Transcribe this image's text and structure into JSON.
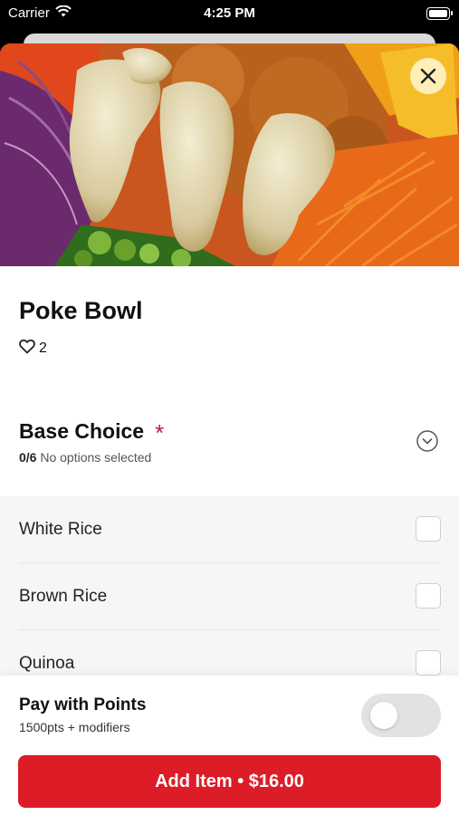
{
  "status_bar": {
    "carrier": "Carrier",
    "time": "4:25 PM"
  },
  "item": {
    "title": "Poke Bowl",
    "likes": "2"
  },
  "section": {
    "title": "Base Choice",
    "required_marker": "*",
    "count": "0/6",
    "status": "No options selected"
  },
  "options": [
    {
      "label": "White Rice"
    },
    {
      "label": "Brown Rice"
    },
    {
      "label": "Quinoa"
    }
  ],
  "footer": {
    "pay_title": "Pay with Points",
    "pay_sub": "1500pts + modifiers",
    "add_button": "Add Item • $16.00"
  },
  "colors": {
    "accent": "#dc1c26",
    "required": "#c2185b"
  },
  "icons": [
    "wifi-icon",
    "battery-icon",
    "close-icon",
    "heart-icon",
    "chevron-down-icon"
  ]
}
